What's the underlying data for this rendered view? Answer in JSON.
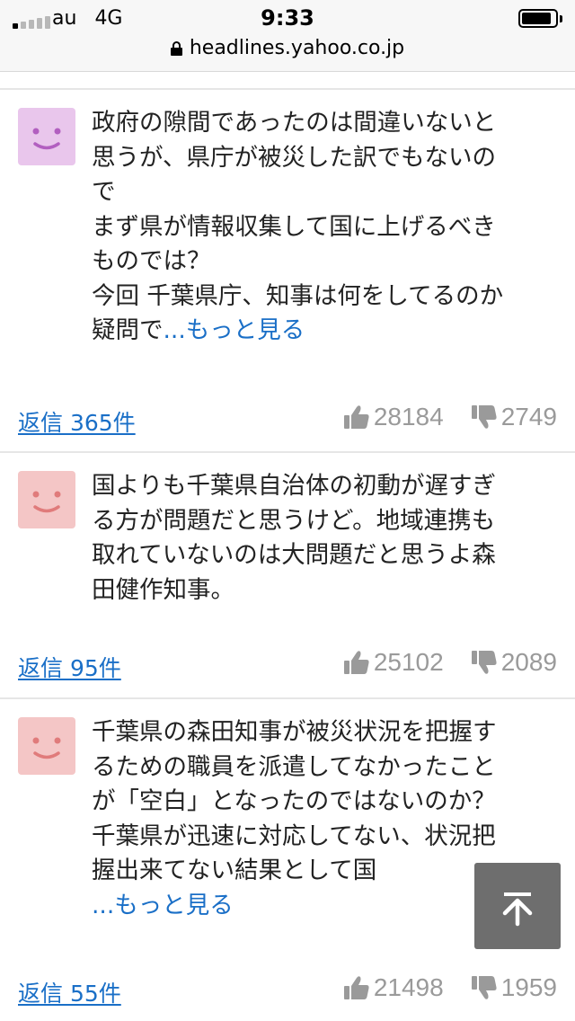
{
  "status_bar": {
    "carrier": "au",
    "network": "4G",
    "time": "9:33",
    "signal_bars_filled": 1,
    "signal_bars_total": 5,
    "battery_level": 0.9
  },
  "url_bar": {
    "url": "headlines.yahoo.co.jp",
    "lock_icon": "lock-icon"
  },
  "colors": {
    "link": "#1a6fc7",
    "vote_gray": "#9a9a9a",
    "avatar_purple": "#e9c6ec",
    "avatar_pink": "#f4c6c6",
    "scroll_button": "#6e6e6e"
  },
  "comments": [
    {
      "avatar": "smiley-face-icon",
      "lines": [
        "政府の隙間であったのは間違いないと",
        "思うが、県庁が被災した訳でもないの",
        "で",
        "まず県が情報収集して国に上げるべき",
        "ものでは？",
        "今回 千葉県庁、知事は何をしてるのか",
        "疑問で"
      ],
      "more": "...もっと見る",
      "reply": "返信 365件",
      "likes": "28184",
      "dislikes": "2749"
    },
    {
      "avatar": "smiley-face-icon",
      "lines": [
        "国よりも千葉県自治体の初動が遅すぎ",
        "る方が問題だと思うけど。地域連携も",
        "取れていないのは大問題だと思うよ森",
        "田健作知事。"
      ],
      "reply": "返信 95件",
      "likes": "25102",
      "dislikes": "2089"
    },
    {
      "avatar": "smiley-face-icon",
      "lines": [
        "千葉県の森田知事が被災状況を把握す",
        "るための職員を派遣してなかったこと",
        "が「空白」となったのではないのか？",
        "千葉県が迅速に対応してない、状況把",
        "握出来てない結果として国"
      ],
      "more": "...もっと見る",
      "reply": "返信 55件",
      "likes": "21498",
      "dislikes": "1959"
    }
  ],
  "scroll_top_button": {
    "icon": "arrow-up-to-top-icon"
  }
}
